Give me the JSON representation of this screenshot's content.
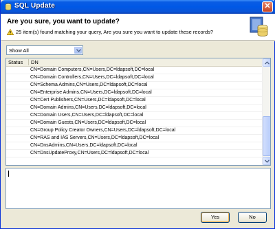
{
  "window": {
    "title": "SQL Update"
  },
  "header": {
    "question": "Are you sure, you want to update?",
    "message": "25 item(s) found matching your query, Are you sure you want to update these records?"
  },
  "filter": {
    "selected": "Show All"
  },
  "table": {
    "columns": [
      "Status",
      "DN"
    ],
    "rows": [
      "CN=Domain Computers,CN=Users,DC=ldapsoft,DC=local",
      "CN=Domain Controllers,CN=Users,DC=ldapsoft,DC=local",
      "CN=Schema Admins,CN=Users,DC=ldapsoft,DC=local",
      "CN=Enterprise Admins,CN=Users,DC=ldapsoft,DC=local",
      "CN=Cert Publishers,CN=Users,DC=ldapsoft,DC=local",
      "CN=Domain Admins,CN=Users,DC=ldapsoft,DC=local",
      "CN=Domain Users,CN=Users,DC=ldapsoft,DC=local",
      "CN=Domain Guests,CN=Users,DC=ldapsoft,DC=local",
      "CN=Group Policy Creator Owners,CN=Users,DC=ldapsoft,DC=local",
      "CN=RAS and IAS Servers,CN=Users,DC=ldapsoft,DC=local",
      "CN=DnsAdmins,CN=Users,DC=ldapsoft,DC=local",
      "CN=DnsUpdateProxy,CN=Users,DC=ldapsoft,DC=local"
    ]
  },
  "buttons": {
    "yes_label": "Yes",
    "no_label": "No"
  },
  "icons": {
    "title": "sql-update-icon",
    "warning": "warning-icon",
    "banner": "database-update-icon",
    "close": "close-icon"
  },
  "colors": {
    "titlebar": "#0058e6",
    "accent": "#f9b34b"
  }
}
